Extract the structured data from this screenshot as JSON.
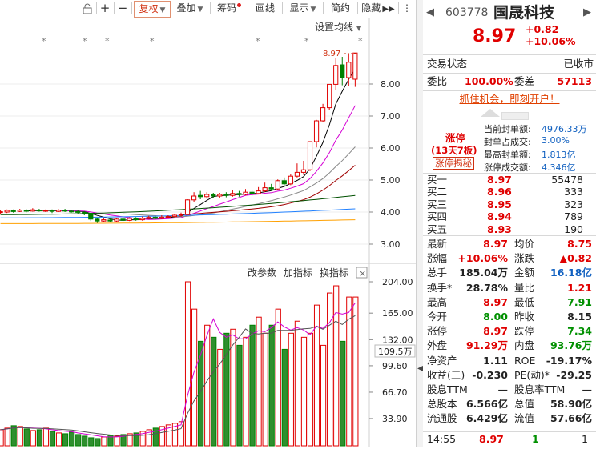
{
  "toolbar": {
    "buttons": [
      "复权",
      "叠加",
      "筹码",
      "画线",
      "显示",
      "简约",
      "隐藏"
    ],
    "settings_ma": "设置均线"
  },
  "chart": {
    "price_tag": "8.97",
    "y_labels": [
      "8.00",
      "7.00",
      "6.00",
      "5.00",
      "4.00",
      "3.00"
    ],
    "vol_labels": [
      "204.00",
      "165.00",
      "132.00",
      "99.60",
      "66.70",
      "33.90"
    ],
    "vol_tag": "109.5万",
    "sub_buttons": [
      "改参数",
      "加指标",
      "换指标"
    ],
    "close_x": "×"
  },
  "chart_data": {
    "type": "candlestick",
    "price_ylim": [
      2.6,
      9.2
    ],
    "price_ticks": [
      8.0,
      7.0,
      6.0,
      5.0,
      4.0,
      3.0
    ],
    "volume_ticks": [
      204.0,
      165.0,
      132.0,
      99.6,
      66.7,
      33.9
    ],
    "current_volume_label": "109.5万",
    "last_price": 8.97
  },
  "header": {
    "code": "603778",
    "name": "国晟科技",
    "price": "8.97",
    "change": "+0.82",
    "change_pct": "+10.06%"
  },
  "status": {
    "label": "交易状态",
    "value": "已收市"
  },
  "ratio": {
    "l1": "委比",
    "v1": "100.00%",
    "l2": "委差",
    "v2": "57113"
  },
  "promo": "抓住机会，即刻开户！",
  "limit": {
    "title": "涨停",
    "streak": "(13天7板)",
    "reveal": "涨停揭秘",
    "rows": [
      {
        "label": "当前封单额:",
        "value": "4976.33万"
      },
      {
        "label": "封单占成交:",
        "value": "3.00%"
      },
      {
        "label": "最高封单额:",
        "value": "1.813亿"
      },
      {
        "label": "涨停成交额:",
        "value": "4.346亿"
      }
    ]
  },
  "bids": [
    {
      "label": "买一",
      "price": "8.97",
      "vol": "55478"
    },
    {
      "label": "买二",
      "price": "8.96",
      "vol": "333"
    },
    {
      "label": "买三",
      "price": "8.95",
      "vol": "323"
    },
    {
      "label": "买四",
      "price": "8.94",
      "vol": "789"
    },
    {
      "label": "买五",
      "price": "8.93",
      "vol": "190"
    }
  ],
  "quote": [
    {
      "l1": "最新",
      "v1": "8.97",
      "c1": "red",
      "l2": "均价",
      "v2": "8.75",
      "c2": "red"
    },
    {
      "l1": "涨幅",
      "v1": "+10.06%",
      "c1": "red",
      "l2": "涨跌",
      "v2": "▲0.82",
      "c2": "red"
    },
    {
      "l1": "总手",
      "v1": "185.04万",
      "c1": "dark",
      "l2": "金额",
      "v2": "16.18亿",
      "c2": "blue"
    },
    {
      "l1": "换手*",
      "v1": "28.78%",
      "c1": "dark",
      "l2": "量比",
      "v2": "1.21",
      "c2": "red"
    },
    {
      "l1": "最高",
      "v1": "8.97",
      "c1": "red",
      "l2": "最低",
      "v2": "7.91",
      "c2": "green"
    },
    {
      "l1": "今开",
      "v1": "8.00",
      "c1": "green",
      "l2": "昨收",
      "v2": "8.15",
      "c2": "dark"
    },
    {
      "l1": "涨停",
      "v1": "8.97",
      "c1": "red",
      "l2": "跌停",
      "v2": "7.34",
      "c2": "green"
    },
    {
      "l1": "外盘",
      "v1": "91.29万",
      "c1": "red",
      "l2": "内盘",
      "v2": "93.76万",
      "c2": "green"
    },
    {
      "l1": "净资产",
      "v1": "1.11",
      "c1": "dark",
      "l2": "ROE",
      "v2": "-19.17%",
      "c2": "dark"
    },
    {
      "l1": "收益(三)",
      "v1": "-0.230",
      "c1": "dark",
      "l2": "PE(动)*",
      "v2": "-29.25",
      "c2": "dark"
    },
    {
      "l1": "股息TTM",
      "v1": "—",
      "c1": "dark",
      "l2": "股息率TTM",
      "v2": "—",
      "c2": "dark"
    },
    {
      "l1": "总股本",
      "v1": "6.566亿",
      "c1": "dark",
      "l2": "总值",
      "v2": "58.90亿",
      "c2": "dark"
    },
    {
      "l1": "流通股",
      "v1": "6.429亿",
      "c1": "dark",
      "l2": "流值",
      "v2": "57.66亿",
      "c2": "dark"
    }
  ],
  "tick": {
    "time": "14:55",
    "price": "8.97",
    "vol": "1",
    "count": "1"
  },
  "colors": {
    "up": "#e00000",
    "down": "#008000",
    "accent": "#d03010",
    "blue": "#1060c0"
  }
}
